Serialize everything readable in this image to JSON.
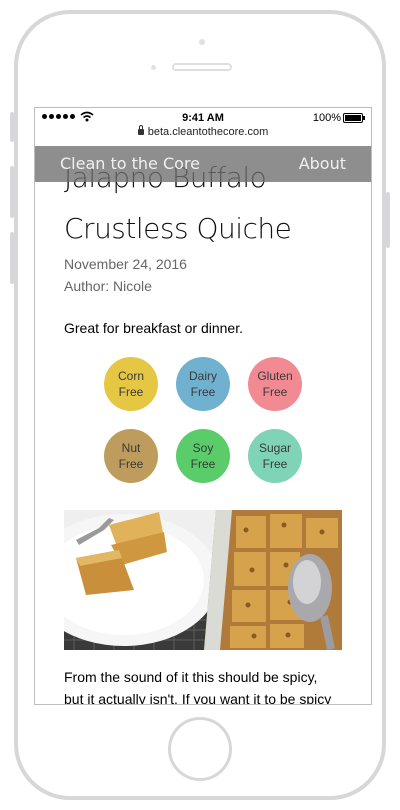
{
  "status_bar": {
    "time": "9:41 AM",
    "battery_percent": "100%"
  },
  "browser": {
    "url": "beta.cleantothecore.com"
  },
  "nav": {
    "brand": "Clean to the Core",
    "about": "About"
  },
  "post": {
    "title_line1": "Jalapno Buffalo",
    "title_line2": "Crustless Quiche",
    "date": "November 24, 2016",
    "author": "Author: Nicole",
    "intro": "Great for breakfast or dinner.",
    "body_line1": "From the sound of it this should be spicy,",
    "body_line2": "but it actually isn't. If you want it to be spicy"
  },
  "badges": [
    {
      "line1": "Corn",
      "line2": "Free",
      "color": "#e6c744"
    },
    {
      "line1": "Dairy",
      "line2": "Free",
      "color": "#6fb1cf"
    },
    {
      "line1": "Gluten",
      "line2": "Free",
      "color": "#f28a94"
    },
    {
      "line1": "Nut",
      "line2": "Free",
      "color": "#bd9c5e"
    },
    {
      "line1": "Soy",
      "line2": "Free",
      "color": "#5bcc6a"
    },
    {
      "line1": "Sugar",
      "line2": "Free",
      "color": "#7fd3b6"
    }
  ]
}
